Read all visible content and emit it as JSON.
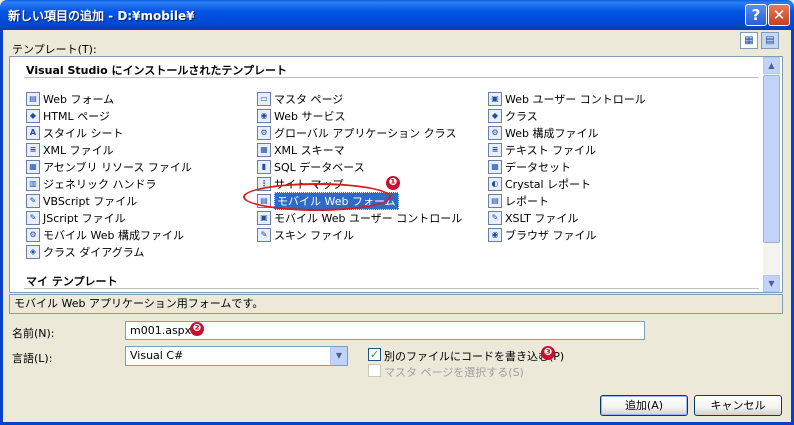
{
  "window": {
    "title": "新しい項目の追加 - D:¥mobile¥",
    "help_glyph": "?",
    "close_glyph": "✕"
  },
  "templates_label": "テンプレート(T):",
  "view_buttons": {
    "large_icon": "large-icons-view-icon",
    "small_icon": "small-icons-view-icon"
  },
  "groups": {
    "installed": "Visual Studio にインストールされたテンプレート",
    "mine": "マイ テンプレート"
  },
  "columns": [
    {
      "items": [
        {
          "label": "Web フォーム",
          "icon": "web-form-icon",
          "glyph": "▤"
        },
        {
          "label": "HTML ページ",
          "icon": "html-page-icon",
          "glyph": "◆"
        },
        {
          "label": "スタイル シート",
          "icon": "stylesheet-icon",
          "glyph": "A"
        },
        {
          "label": "XML ファイル",
          "icon": "xml-file-icon",
          "glyph": "≡"
        },
        {
          "label": "アセンブリ リソース ファイル",
          "icon": "resource-file-icon",
          "glyph": "▦"
        },
        {
          "label": "ジェネリック ハンドラ",
          "icon": "generic-handler-icon",
          "glyph": "▥"
        },
        {
          "label": "VBScript ファイル",
          "icon": "vbscript-file-icon",
          "glyph": "✎"
        },
        {
          "label": "JScript ファイル",
          "icon": "jscript-file-icon",
          "glyph": "✎"
        },
        {
          "label": "モバイル Web 構成ファイル",
          "icon": "mobile-config-icon",
          "glyph": "⚙"
        },
        {
          "label": "クラス ダイアグラム",
          "icon": "class-diagram-icon",
          "glyph": "◈"
        }
      ]
    },
    {
      "items": [
        {
          "label": "マスタ ページ",
          "icon": "master-page-icon",
          "glyph": "▭"
        },
        {
          "label": "Web サービス",
          "icon": "web-service-icon",
          "glyph": "◉"
        },
        {
          "label": "グローバル アプリケーション クラス",
          "icon": "global-app-class-icon",
          "glyph": "⚙"
        },
        {
          "label": "XML スキーマ",
          "icon": "xml-schema-icon",
          "glyph": "▦"
        },
        {
          "label": "SQL データベース",
          "icon": "sql-database-icon",
          "glyph": "▮"
        },
        {
          "label": "サイト マップ",
          "icon": "site-map-icon",
          "glyph": "⋮"
        },
        {
          "label": "モバイル Web フォーム",
          "icon": "mobile-web-form-icon",
          "glyph": "▤"
        },
        {
          "label": "モバイル Web ユーザー コントロール",
          "icon": "mobile-user-control-icon",
          "glyph": "▣"
        },
        {
          "label": "スキン ファイル",
          "icon": "skin-file-icon",
          "glyph": "✎"
        }
      ]
    },
    {
      "items": [
        {
          "label": "Web ユーザー コントロール",
          "icon": "web-user-control-icon",
          "glyph": "▣"
        },
        {
          "label": "クラス",
          "icon": "class-icon",
          "glyph": "◆"
        },
        {
          "label": "Web 構成ファイル",
          "icon": "web-config-icon",
          "glyph": "⚙"
        },
        {
          "label": "テキスト ファイル",
          "icon": "text-file-icon",
          "glyph": "≡"
        },
        {
          "label": "データセット",
          "icon": "dataset-icon",
          "glyph": "▦"
        },
        {
          "label": "Crystal レポート",
          "icon": "crystal-report-icon",
          "glyph": "◐"
        },
        {
          "label": "レポート",
          "icon": "report-icon",
          "glyph": "▤"
        },
        {
          "label": "XSLT ファイル",
          "icon": "xslt-file-icon",
          "glyph": "✎"
        },
        {
          "label": "ブラウザ ファイル",
          "icon": "browser-file-icon",
          "glyph": "◉"
        }
      ]
    }
  ],
  "description": "モバイル Web アプリケーション用フォームです。",
  "name_field": {
    "label": "名前(N):",
    "value": "m001.aspx"
  },
  "language_field": {
    "label": "言語(L):",
    "value": "Visual C#"
  },
  "options": {
    "separate_file": {
      "label": "別のファイルにコードを書き込む(P)",
      "checked": true
    },
    "select_master": {
      "label": "マスタ ページを選択する(S)",
      "checked": false,
      "enabled": false
    }
  },
  "buttons": {
    "add": "追加(A)",
    "cancel": "キャンセル"
  },
  "callouts": [
    "❶",
    "❷",
    "❸"
  ],
  "colors": {
    "title_bar": "#0054e3",
    "selection": "#316ac5",
    "callout_red": "#c8102e"
  }
}
